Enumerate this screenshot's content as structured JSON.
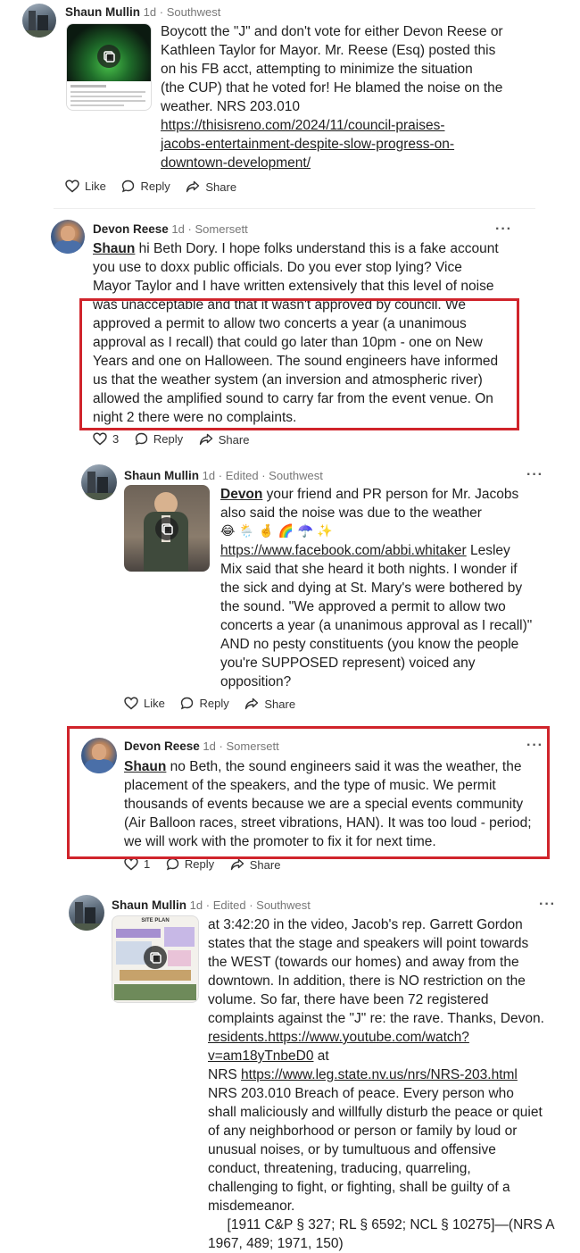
{
  "posts": [
    {
      "author": "Shaun Mullin",
      "time": "1d",
      "location": "Southwest",
      "lines": [
        "Boycott the \"J\" and don't vote for either Devon Reese or",
        "Kathleen Taylor for Mayor. Mr. Reese (Esq) posted this",
        "on his FB acct, attempting to minimize the situation",
        "(the CUP) that he voted for! He blamed the noise on the",
        "weather. NRS  203.010"
      ],
      "link_lines": [
        "https://thisisreno.com/2024/11/council-praises-",
        "jacobs-entertainment-despite-slow-progress-on-",
        "downtown-development/"
      ],
      "like_label": "Like",
      "reply_label": "Reply",
      "share_label": "Share"
    },
    {
      "author": "Devon Reese",
      "time": "1d",
      "location": "Somersett",
      "mention": "Shaun",
      "first_line_rest": " hi Beth Dory. I hope folks understand this is a fake account",
      "lines": [
        "you use to doxx public officials. Do you ever stop lying? Vice",
        "Mayor Taylor and I have written extensively that this level of noise",
        "was unacceptable and that it wasn't approved by council. We",
        "approved a permit to allow two concerts a year (a unanimous",
        "approval as I recall) that could go later than 10pm - one on New",
        "Years and one on Halloween. The sound engineers have informed",
        "us that the weather system (an inversion and atmospheric river)",
        "allowed the amplified sound to carry far from the event venue.  On",
        "night 2 there were no complaints."
      ],
      "like_count": "3",
      "reply_label": "Reply",
      "share_label": "Share"
    },
    {
      "author": "Shaun Mullin",
      "time": "1d",
      "edited": "Edited",
      "location": "Southwest",
      "mention": "Devon",
      "first_line_rest": " your friend and PR person for Mr. Jacobs",
      "line2": "also said the noise was due to the weather",
      "emoji_line": "😂 🌦️ 🤞 🌈 ☂️ ✨",
      "link": "https://www.facebook.com/abbi.whitaker",
      "link_rest": " Lesley",
      "lines": [
        "Mix said that she heard it both nights. I wonder if",
        "the sick and dying at St. Mary's were bothered by",
        "the sound. \"We approved a permit to allow two",
        "concerts a year (a unanimous approval as I recall)\"",
        "AND no pesty constituents (you know the people",
        "you're SUPPOSED represent) voiced any",
        "opposition?"
      ],
      "like_label": "Like",
      "reply_label": "Reply",
      "share_label": "Share"
    },
    {
      "author": "Devon Reese",
      "time": "1d",
      "location": "Somersett",
      "mention": "Shaun",
      "first_line_rest": " no Beth, the sound engineers said it was the weather, the",
      "lines": [
        "placement of the speakers, and the type of music. We permit",
        "thousands of events because we are a special events community",
        "(Air Balloon races, street vibrations, HAN). It was too loud - period;",
        "we will work with the promoter to fix it for next time."
      ],
      "like_count": "1",
      "reply_label": "Reply",
      "share_label": "Share"
    },
    {
      "author": "Shaun Mullin",
      "time": "1d",
      "edited": "Edited",
      "location": "Southwest",
      "lines": [
        "at 3:42:20 in the video, Jacob's rep. Garrett Gordon",
        "states that the stage and speakers will point towards",
        "the WEST (towards our homes) and away from the",
        "downtown.  In addition, there is NO restriction on the",
        "volume. So far, there have been 72 registered",
        "complaints against the \"J\" re: the rave. Thanks, Devon."
      ],
      "url_line_a": "residents.https://www.youtube.com/watch?",
      "url_line_b": "v=am18yTnbeD0",
      "url_line_b_rest": " at",
      "nrs_prefix": "NRS ",
      "nrs_link": "https://www.leg.state.nv.us/nrs/NRS-203.html",
      "lines2": [
        "NRS  203.010     Breach of peace.     Every person who",
        "shall maliciously and willfully disturb the peace or quiet",
        "of any neighborhood or person or family by loud or",
        "unusual noises, or by tumultuous and offensive",
        "conduct, threatening, traducing, quarreling,",
        "challenging to fight, or fighting, shall be guilty of a",
        "misdemeanor.",
        "     [1911 C&P § 327; RL § 6592; NCL § 10275]—(NRS A",
        "1967, 489; 1971, 150)"
      ],
      "thumb_title": "SITE PLAN"
    }
  ],
  "meta_sep": "·",
  "more_icon": "···",
  "colors": {
    "highlight": "#d0242b"
  }
}
